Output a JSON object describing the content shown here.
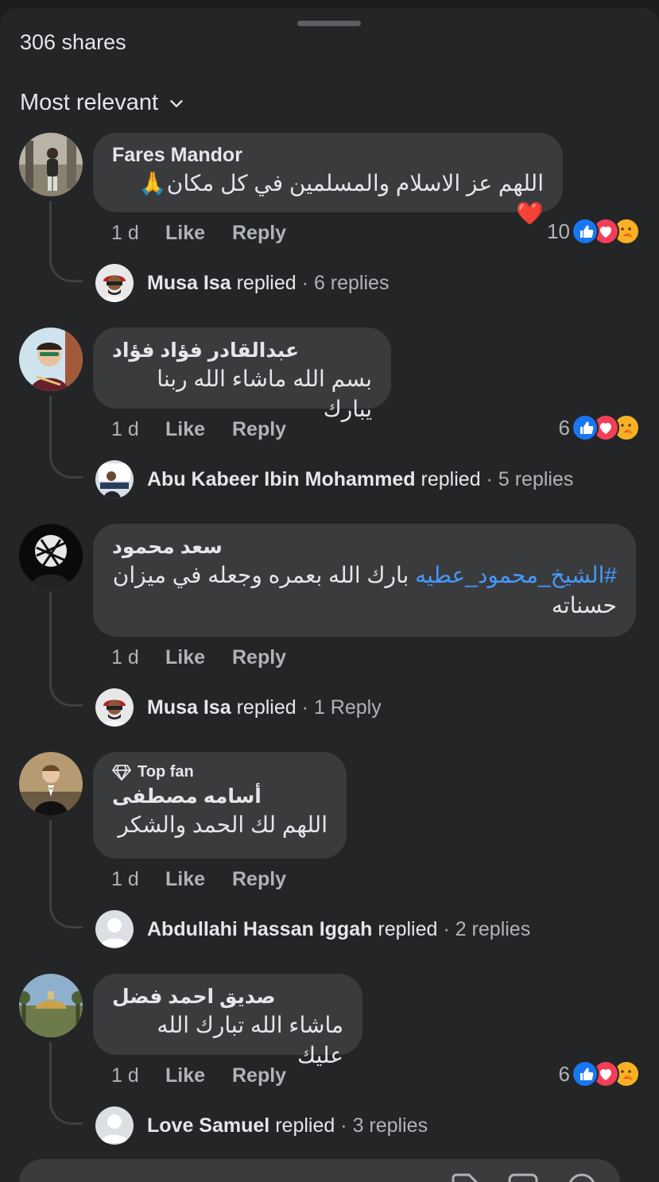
{
  "header": {
    "shares": "306 shares",
    "sort_label": "Most relevant"
  },
  "comments": [
    {
      "name": "Fares Mandor",
      "text": "اللهم عز الاسلام والمسلمين في كل مكان🙏❤️",
      "time": "1 d",
      "like": "Like",
      "reply": "Reply",
      "reaction_count": "10",
      "reply_author": "Musa Isa",
      "reply_verb": "replied",
      "reply_count": "· 6 replies"
    },
    {
      "name": "عبدالقادر فؤاد فؤاد",
      "text": "بسم الله ماشاء الله ربنا يبارك",
      "time": "1 d",
      "like": "Like",
      "reply": "Reply",
      "reaction_count": "6",
      "reply_author": "Abu Kabeer Ibin Mohammed",
      "reply_verb": "replied",
      "reply_count": "· 5 replies"
    },
    {
      "name": "سعد محمود",
      "hashtag": "#الشيخ_محمود_عطيه",
      "text": " بارك الله بعمره وجعله في ميزان حسناته",
      "time": "1 d",
      "like": "Like",
      "reply": "Reply",
      "reply_author": "Musa Isa",
      "reply_verb": "replied",
      "reply_count": "· 1 Reply"
    },
    {
      "badge": "Top fan",
      "name": "أسامه مصطفى",
      "text": "اللهم لك الحمد والشكر",
      "time": "1 d",
      "like": "Like",
      "reply": "Reply",
      "reply_author": "Abdullahi Hassan Iggah",
      "reply_verb": "replied",
      "reply_count": "· 2 replies"
    },
    {
      "name": "صديق احمد فضل",
      "text": "ماشاء الله تبارك الله عليك",
      "time": "1 d",
      "like": "Like",
      "reply": "Reply",
      "reaction_count": "6",
      "reply_author": "Love Samuel",
      "reply_verb": "replied",
      "reply_count": "· 3 replies"
    }
  ],
  "icons": {
    "sort": "chevron-down-icon",
    "reactions": [
      "like-icon",
      "love-icon",
      "care-icon"
    ],
    "badge": "diamond-icon"
  },
  "colors": {
    "background": "#242527",
    "bubble": "#3a3b3d",
    "hashtag": "#4599ff",
    "like": "#1877f2",
    "love": "#f33e58"
  }
}
